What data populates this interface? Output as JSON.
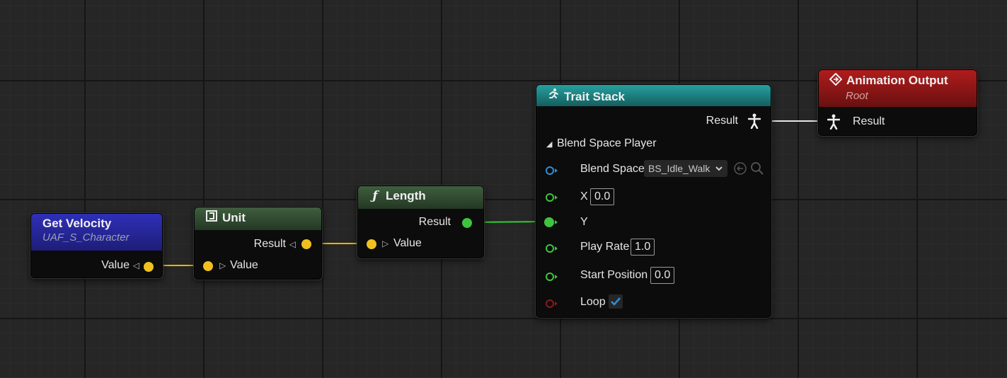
{
  "nodes": {
    "get_velocity": {
      "title": "Get Velocity",
      "subtitle": "UAF_S_Character",
      "output_label": "Value"
    },
    "unit": {
      "title": "Unit",
      "output_label": "Result",
      "input_label": "Value"
    },
    "length": {
      "title": "Length",
      "icon_glyph": "ƒ",
      "output_label": "Result",
      "input_label": "Value"
    },
    "trait_stack": {
      "title": "Trait Stack",
      "output_label": "Result",
      "section": "Blend Space Player",
      "blend_space_label": "Blend Space",
      "blend_space_value": "BS_Idle_Walk",
      "x_label": "X",
      "x_value": "0.0",
      "y_label": "Y",
      "play_rate_label": "Play Rate",
      "play_rate_value": "1.0",
      "start_position_label": "Start Position",
      "start_position_value": "0.0",
      "loop_label": "Loop",
      "loop_checked": true
    },
    "animation_output": {
      "title": "Animation Output",
      "subtitle": "Root",
      "input_label": "Result"
    }
  },
  "colors": {
    "float_pin": "#f0c020",
    "bool_pin_float": "#3ec43e",
    "object_pin": "#2e8fd6",
    "loop_pin": "#8b1a1a",
    "wire_float": "#e8b800",
    "wire_green": "#33cc33",
    "wire_white": "#e6e6e6",
    "header_blue": "#2a2aa0",
    "header_green": "#2e4a2e",
    "header_teal": "#1e7a7a",
    "header_red": "#a01818"
  }
}
